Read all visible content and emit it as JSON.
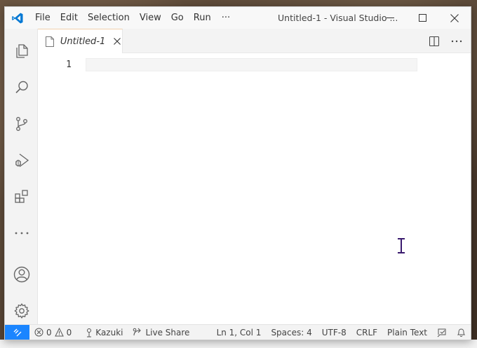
{
  "window": {
    "title": "Untitled-1 - Visual Studio ...",
    "menu": [
      "File",
      "Edit",
      "Selection",
      "View",
      "Go",
      "Run"
    ],
    "menu_more": "···"
  },
  "activitybar": {
    "items": [
      "explorer-icon",
      "search-icon",
      "source-control-icon",
      "run-debug-icon",
      "extensions-icon",
      "more-icon",
      "account-icon",
      "manage-gear-icon"
    ]
  },
  "tabs": [
    {
      "label": "Untitled-1",
      "icon": "file-icon"
    }
  ],
  "editor": {
    "line_numbers": [
      "1"
    ]
  },
  "statusbar": {
    "errors": "0",
    "warnings": "0",
    "user": "Kazuki",
    "live_share": "Live Share",
    "position": "Ln 1, Col 1",
    "spaces": "Spaces: 4",
    "encoding": "UTF-8",
    "eol": "CRLF",
    "language": "Plain Text"
  },
  "colors": {
    "accent": "#1a85ff",
    "vscode_logo": "#0078d4",
    "tab_border": "#f0d0ad"
  }
}
